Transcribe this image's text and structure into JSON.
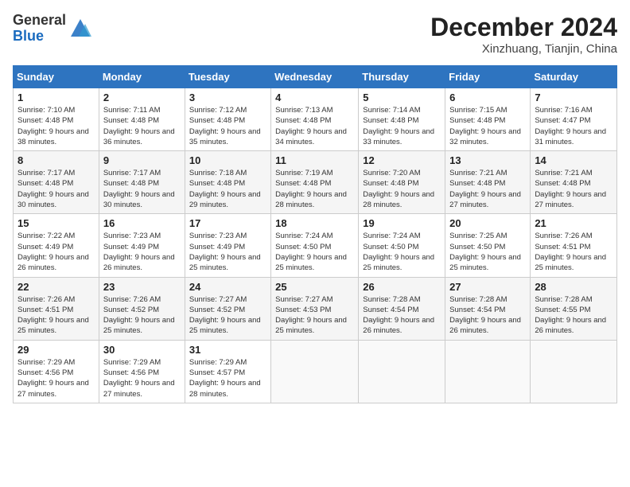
{
  "logo": {
    "general": "General",
    "blue": "Blue"
  },
  "title": "December 2024",
  "location": "Xinzhuang, Tianjin, China",
  "weekdays": [
    "Sunday",
    "Monday",
    "Tuesday",
    "Wednesday",
    "Thursday",
    "Friday",
    "Saturday"
  ],
  "weeks": [
    [
      {
        "day": "1",
        "sunrise": "7:10 AM",
        "sunset": "4:48 PM",
        "daylight": "9 hours and 38 minutes."
      },
      {
        "day": "2",
        "sunrise": "7:11 AM",
        "sunset": "4:48 PM",
        "daylight": "9 hours and 36 minutes."
      },
      {
        "day": "3",
        "sunrise": "7:12 AM",
        "sunset": "4:48 PM",
        "daylight": "9 hours and 35 minutes."
      },
      {
        "day": "4",
        "sunrise": "7:13 AM",
        "sunset": "4:48 PM",
        "daylight": "9 hours and 34 minutes."
      },
      {
        "day": "5",
        "sunrise": "7:14 AM",
        "sunset": "4:48 PM",
        "daylight": "9 hours and 33 minutes."
      },
      {
        "day": "6",
        "sunrise": "7:15 AM",
        "sunset": "4:48 PM",
        "daylight": "9 hours and 32 minutes."
      },
      {
        "day": "7",
        "sunrise": "7:16 AM",
        "sunset": "4:47 PM",
        "daylight": "9 hours and 31 minutes."
      }
    ],
    [
      {
        "day": "8",
        "sunrise": "7:17 AM",
        "sunset": "4:48 PM",
        "daylight": "9 hours and 30 minutes."
      },
      {
        "day": "9",
        "sunrise": "7:17 AM",
        "sunset": "4:48 PM",
        "daylight": "9 hours and 30 minutes."
      },
      {
        "day": "10",
        "sunrise": "7:18 AM",
        "sunset": "4:48 PM",
        "daylight": "9 hours and 29 minutes."
      },
      {
        "day": "11",
        "sunrise": "7:19 AM",
        "sunset": "4:48 PM",
        "daylight": "9 hours and 28 minutes."
      },
      {
        "day": "12",
        "sunrise": "7:20 AM",
        "sunset": "4:48 PM",
        "daylight": "9 hours and 28 minutes."
      },
      {
        "day": "13",
        "sunrise": "7:21 AM",
        "sunset": "4:48 PM",
        "daylight": "9 hours and 27 minutes."
      },
      {
        "day": "14",
        "sunrise": "7:21 AM",
        "sunset": "4:48 PM",
        "daylight": "9 hours and 27 minutes."
      }
    ],
    [
      {
        "day": "15",
        "sunrise": "7:22 AM",
        "sunset": "4:49 PM",
        "daylight": "9 hours and 26 minutes."
      },
      {
        "day": "16",
        "sunrise": "7:23 AM",
        "sunset": "4:49 PM",
        "daylight": "9 hours and 26 minutes."
      },
      {
        "day": "17",
        "sunrise": "7:23 AM",
        "sunset": "4:49 PM",
        "daylight": "9 hours and 25 minutes."
      },
      {
        "day": "18",
        "sunrise": "7:24 AM",
        "sunset": "4:50 PM",
        "daylight": "9 hours and 25 minutes."
      },
      {
        "day": "19",
        "sunrise": "7:24 AM",
        "sunset": "4:50 PM",
        "daylight": "9 hours and 25 minutes."
      },
      {
        "day": "20",
        "sunrise": "7:25 AM",
        "sunset": "4:50 PM",
        "daylight": "9 hours and 25 minutes."
      },
      {
        "day": "21",
        "sunrise": "7:26 AM",
        "sunset": "4:51 PM",
        "daylight": "9 hours and 25 minutes."
      }
    ],
    [
      {
        "day": "22",
        "sunrise": "7:26 AM",
        "sunset": "4:51 PM",
        "daylight": "9 hours and 25 minutes."
      },
      {
        "day": "23",
        "sunrise": "7:26 AM",
        "sunset": "4:52 PM",
        "daylight": "9 hours and 25 minutes."
      },
      {
        "day": "24",
        "sunrise": "7:27 AM",
        "sunset": "4:52 PM",
        "daylight": "9 hours and 25 minutes."
      },
      {
        "day": "25",
        "sunrise": "7:27 AM",
        "sunset": "4:53 PM",
        "daylight": "9 hours and 25 minutes."
      },
      {
        "day": "26",
        "sunrise": "7:28 AM",
        "sunset": "4:54 PM",
        "daylight": "9 hours and 26 minutes."
      },
      {
        "day": "27",
        "sunrise": "7:28 AM",
        "sunset": "4:54 PM",
        "daylight": "9 hours and 26 minutes."
      },
      {
        "day": "28",
        "sunrise": "7:28 AM",
        "sunset": "4:55 PM",
        "daylight": "9 hours and 26 minutes."
      }
    ],
    [
      {
        "day": "29",
        "sunrise": "7:29 AM",
        "sunset": "4:56 PM",
        "daylight": "9 hours and 27 minutes."
      },
      {
        "day": "30",
        "sunrise": "7:29 AM",
        "sunset": "4:56 PM",
        "daylight": "9 hours and 27 minutes."
      },
      {
        "day": "31",
        "sunrise": "7:29 AM",
        "sunset": "4:57 PM",
        "daylight": "9 hours and 28 minutes."
      },
      null,
      null,
      null,
      null
    ]
  ],
  "labels": {
    "sunrise": "Sunrise:",
    "sunset": "Sunset:",
    "daylight": "Daylight:"
  }
}
